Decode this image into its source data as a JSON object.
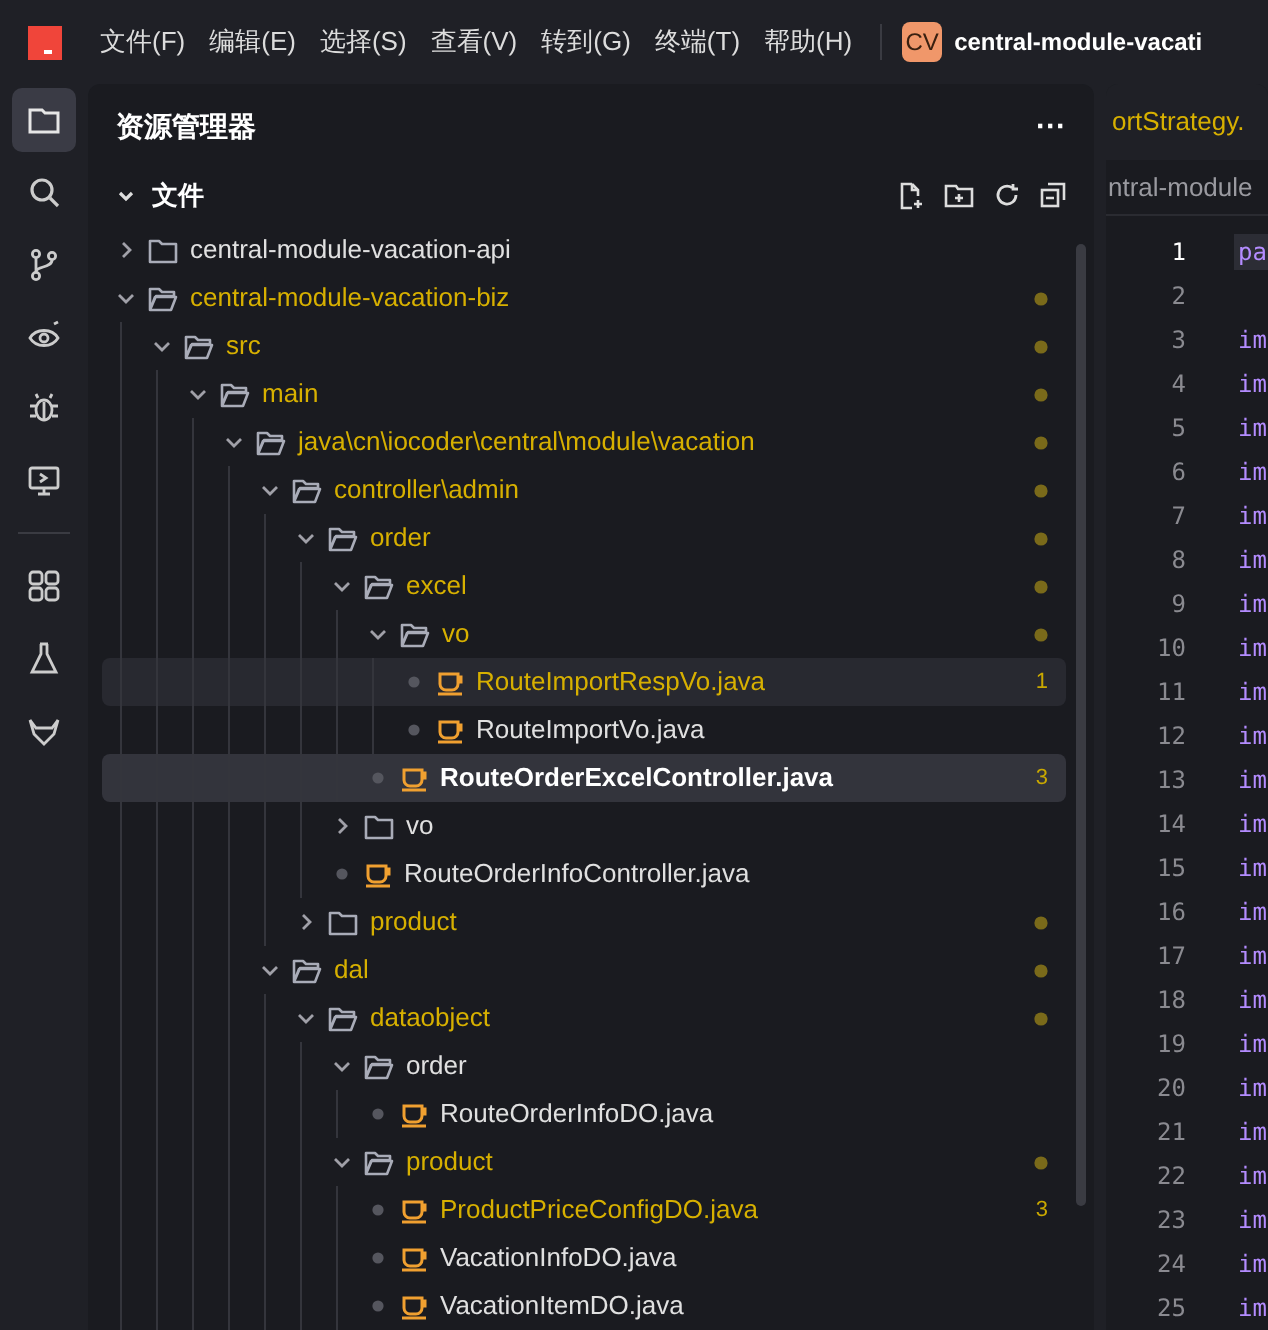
{
  "menu": [
    "文件(F)",
    "编辑(E)",
    "选择(S)",
    "查看(V)",
    "转到(G)",
    "终端(T)",
    "帮助(H)"
  ],
  "project": {
    "badge": "CV",
    "title": "central-module-vacati"
  },
  "activity_bar": [
    {
      "selected": true
    },
    {
      "selected": false
    },
    {
      "selected": false
    },
    {
      "selected": false
    },
    {
      "selected": false
    },
    {
      "selected": false
    },
    {
      "selected": false
    },
    {
      "selected": false
    },
    {
      "selected": false
    }
  ],
  "explorer": {
    "title": "资源管理器",
    "more": "···",
    "section": {
      "title": "文件",
      "expanded": true
    },
    "tree": [
      {
        "kind": "folder",
        "name": "central-module-vacation-api",
        "expanded": false,
        "modified": false
      },
      {
        "kind": "folder",
        "name": "central-module-vacation-biz",
        "expanded": true,
        "modified": true,
        "children": [
          {
            "kind": "folder",
            "name": "src",
            "expanded": true,
            "modified": true,
            "children": [
              {
                "kind": "folder",
                "name": "main",
                "expanded": true,
                "modified": true,
                "children": [
                  {
                    "kind": "folder",
                    "name": "java\\cn\\iocoder\\central\\module\\vacation",
                    "expanded": true,
                    "modified": true,
                    "children": [
                      {
                        "kind": "folder",
                        "name": "controller\\admin",
                        "expanded": true,
                        "modified": true,
                        "children": [
                          {
                            "kind": "folder",
                            "name": "order",
                            "expanded": true,
                            "modified": true,
                            "children": [
                              {
                                "kind": "folder",
                                "name": "excel",
                                "expanded": true,
                                "modified": true,
                                "children": [
                                  {
                                    "kind": "folder",
                                    "name": "vo",
                                    "expanded": true,
                                    "modified": true,
                                    "children": [
                                      {
                                        "kind": "file",
                                        "name": "RouteImportRespVo.java",
                                        "modified": true,
                                        "badge": "1",
                                        "selected": false,
                                        "hovered": true
                                      },
                                      {
                                        "kind": "file",
                                        "name": "RouteImportVo.java",
                                        "modified": false,
                                        "selected": false,
                                        "hovered": false
                                      }
                                    ]
                                  },
                                  {
                                    "kind": "file",
                                    "name": "RouteOrderExcelController.java",
                                    "modified": false,
                                    "badge": "3",
                                    "selected": true,
                                    "hovered": false
                                  }
                                ]
                              },
                              {
                                "kind": "folder",
                                "name": "vo",
                                "expanded": false,
                                "modified": false
                              },
                              {
                                "kind": "file",
                                "name": "RouteOrderInfoController.java",
                                "modified": false,
                                "selected": false,
                                "hovered": false
                              }
                            ]
                          },
                          {
                            "kind": "folder",
                            "name": "product",
                            "expanded": false,
                            "modified": true
                          }
                        ]
                      },
                      {
                        "kind": "folder",
                        "name": "dal",
                        "expanded": true,
                        "modified": true,
                        "children": [
                          {
                            "kind": "folder",
                            "name": "dataobject",
                            "expanded": true,
                            "modified": true,
                            "children": [
                              {
                                "kind": "folder",
                                "name": "order",
                                "expanded": true,
                                "modified": false,
                                "children": [
                                  {
                                    "kind": "file",
                                    "name": "RouteOrderInfoDO.java",
                                    "modified": false,
                                    "selected": false,
                                    "hovered": false
                                  }
                                ]
                              },
                              {
                                "kind": "folder",
                                "name": "product",
                                "expanded": true,
                                "modified": true,
                                "children": [
                                  {
                                    "kind": "file",
                                    "name": "ProductPriceConfigDO.java",
                                    "modified": true,
                                    "badge": "3",
                                    "selected": false,
                                    "hovered": false
                                  },
                                  {
                                    "kind": "file",
                                    "name": "VacationInfoDO.java",
                                    "modified": false,
                                    "selected": false,
                                    "hovered": false
                                  },
                                  {
                                    "kind": "file",
                                    "name": "VacationItemDO.java",
                                    "modified": false,
                                    "selected": false,
                                    "hovered": false
                                  }
                                ]
                              }
                            ]
                          }
                        ]
                      }
                    ]
                  }
                ]
              }
            ]
          }
        ]
      }
    ]
  },
  "editor": {
    "tab": "ortStrategy.",
    "breadcrumb": "ntral-module",
    "lines": [
      {
        "number": "1",
        "code": "pa",
        "current": true
      },
      {
        "number": "2",
        "current": false
      },
      {
        "number": "3",
        "code": "im",
        "current": false
      },
      {
        "number": "4",
        "code": "im",
        "current": false
      },
      {
        "number": "5",
        "code": "im",
        "current": false
      },
      {
        "number": "6",
        "code": "im",
        "current": false
      },
      {
        "number": "7",
        "code": "im",
        "current": false
      },
      {
        "number": "8",
        "code": "im",
        "current": false
      },
      {
        "number": "9",
        "code": "im",
        "current": false
      },
      {
        "number": "10",
        "code": "im",
        "current": false
      },
      {
        "number": "11",
        "code": "im",
        "current": false
      },
      {
        "number": "12",
        "code": "im",
        "current": false
      },
      {
        "number": "13",
        "code": "im",
        "current": false
      },
      {
        "number": "14",
        "code": "im",
        "current": false
      },
      {
        "number": "15",
        "code": "im",
        "current": false
      },
      {
        "number": "16",
        "code": "im",
        "current": false
      },
      {
        "number": "17",
        "code": "im",
        "current": false
      },
      {
        "number": "18",
        "code": "im",
        "current": false
      },
      {
        "number": "19",
        "code": "im",
        "current": false
      },
      {
        "number": "20",
        "code": "im",
        "current": false
      },
      {
        "number": "21",
        "code": "im",
        "current": false
      },
      {
        "number": "22",
        "code": "im",
        "current": false
      },
      {
        "number": "23",
        "code": "im",
        "current": false
      },
      {
        "number": "24",
        "code": "im",
        "current": false
      },
      {
        "number": "25",
        "code": "im",
        "current": false
      }
    ]
  }
}
